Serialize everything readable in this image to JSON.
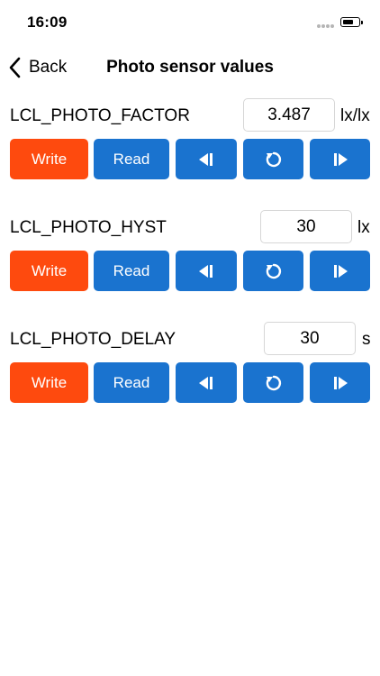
{
  "status_bar": {
    "time": "16:09"
  },
  "nav": {
    "back_label": "Back",
    "title": "Photo sensor values"
  },
  "buttons": {
    "write_label": "Write",
    "read_label": "Read"
  },
  "params": [
    {
      "name": "LCL_PHOTO_FACTOR",
      "value": "3.487",
      "unit": "lx/lx"
    },
    {
      "name": "LCL_PHOTO_HYST",
      "value": "30",
      "unit": "lx"
    },
    {
      "name": "LCL_PHOTO_DELAY",
      "value": "30",
      "unit": "s"
    }
  ],
  "colors": {
    "write_button": "#fe4a0e",
    "action_button": "#1a73cf",
    "field_border": "#d6d6d6"
  },
  "icons": {
    "back": "chevron-left-icon",
    "previous": "step-back-icon",
    "reset": "reset-icon",
    "next": "step-forward-icon"
  }
}
